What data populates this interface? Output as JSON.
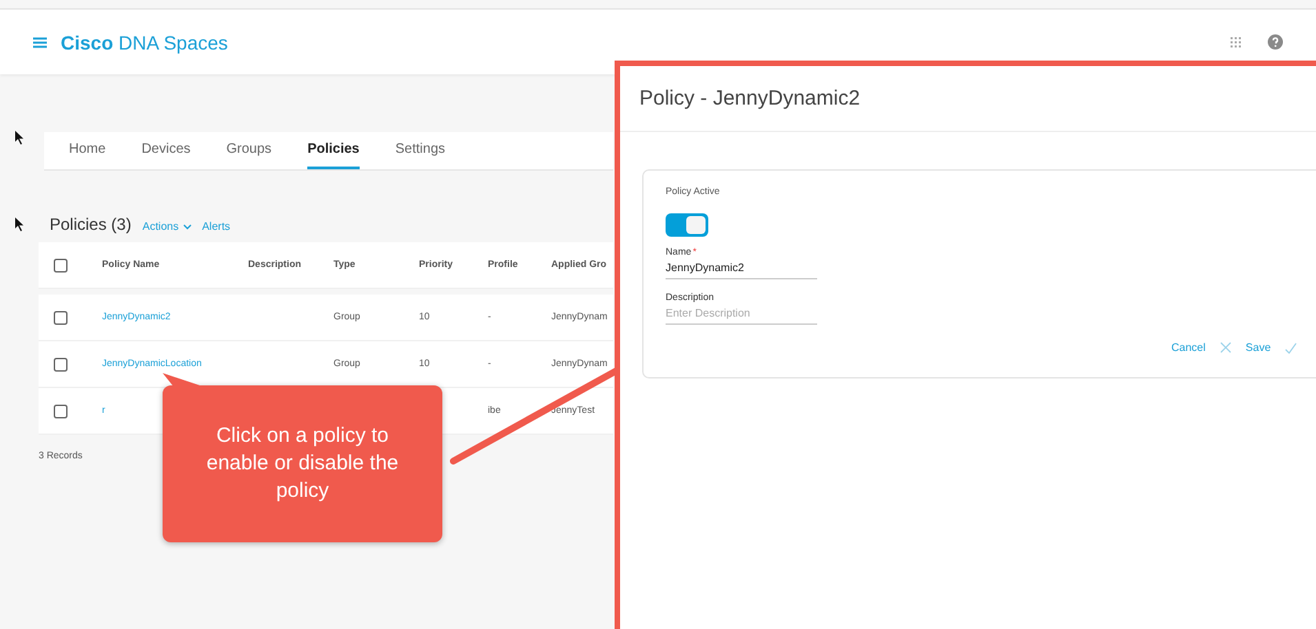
{
  "header": {
    "brand_bold": "Cisco",
    "brand_rest": "DNA Spaces"
  },
  "tabs": [
    {
      "label": "Home",
      "selected": false
    },
    {
      "label": "Devices",
      "selected": false
    },
    {
      "label": "Groups",
      "selected": false
    },
    {
      "label": "Policies",
      "selected": true
    },
    {
      "label": "Settings",
      "selected": false
    }
  ],
  "policies": {
    "title": "Policies (3)",
    "actions": "Actions",
    "alerts": "Alerts",
    "select_all_checked": false,
    "columns": [
      "Policy Name",
      "Description",
      "Type",
      "Priority",
      "Profile",
      "Applied Gro"
    ],
    "rows": [
      {
        "checked": false,
        "cells": [
          "JennyDynamic2",
          "",
          "Group",
          "10",
          "-",
          "JennyDynam"
        ]
      },
      {
        "checked": false,
        "cells": [
          "JennyDynamicLocation",
          "",
          "Group",
          "10",
          "-",
          "JennyDynam"
        ]
      },
      {
        "checked": false,
        "cells": [
          "r",
          "",
          "",
          "",
          "ibe",
          "JennyTest"
        ]
      }
    ],
    "records": "3 Records"
  },
  "drawer": {
    "title": "Policy - JennyDynamic2",
    "active_label": "Policy Active",
    "active": true,
    "name_label": "Name",
    "required_mark": "*",
    "name_value": "JennyDynamic2",
    "description_label": "Description",
    "description_placeholder": "Enter Description",
    "cancel": "Cancel",
    "save": "Save"
  },
  "callout": {
    "text": "Click on a policy to enable or disable the policy"
  }
}
